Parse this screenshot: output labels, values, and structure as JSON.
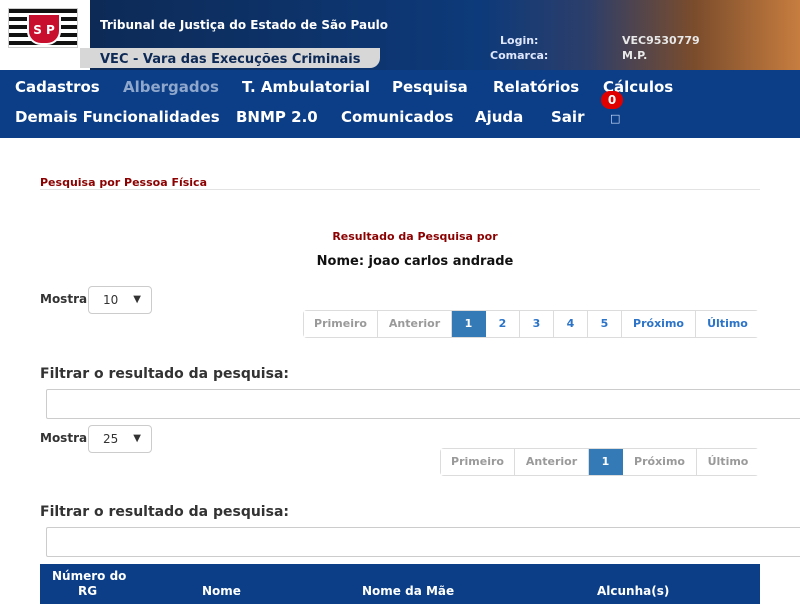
{
  "header": {
    "logo_text": "S P",
    "org_title": "Tribunal de Justiça do Estado de São Paulo",
    "system_name": "VEC - Vara das Execuções Criminais",
    "login_label": "Login:",
    "login_value": "VEC9530779",
    "comarca_label": "Comarca:",
    "comarca_value": "M.P."
  },
  "nav": {
    "row1": [
      "Cadastros",
      "Albergados",
      "T. Ambulatorial",
      "Pesquisa",
      "Relatórios",
      "Cálculos"
    ],
    "row2": [
      "Demais Funcionalidades",
      "BNMP 2.0",
      "Comunicados",
      "Ajuda",
      "Sair"
    ],
    "disabled": [
      "Albergados"
    ],
    "badge_count": "0",
    "notification_icon": "bell-icon"
  },
  "page": {
    "section_title": "Pesquisa por Pessoa Física",
    "result_label": "Resultado da Pesquisa por",
    "result_value": "Nome: joao carlos andrade"
  },
  "list1": {
    "show_label": "Mostrar",
    "page_size": "10",
    "pager": [
      "Primeiro",
      "Anterior",
      "1",
      "2",
      "3",
      "4",
      "5",
      "Próximo",
      "Último"
    ],
    "active_page": "1",
    "filter_label": "Filtrar o resultado da pesquisa:"
  },
  "list2": {
    "show_label": "Mostrar",
    "page_size": "25",
    "pager": [
      "Primeiro",
      "Anterior",
      "1",
      "Próximo",
      "Último"
    ],
    "active_page": "1",
    "filter_label": "Filtrar o resultado da pesquisa:"
  },
  "table": {
    "columns": [
      "Número do RG",
      "Nome",
      "Nome da Mãe",
      "Alcunha(s)"
    ],
    "col_rg_line1": "Número do",
    "col_rg_line2": "RG"
  },
  "colors": {
    "nav_bg": "#0b3e86",
    "section_title": "#8b0000",
    "pager_active": "#337ab7",
    "badge": "#e00000"
  }
}
